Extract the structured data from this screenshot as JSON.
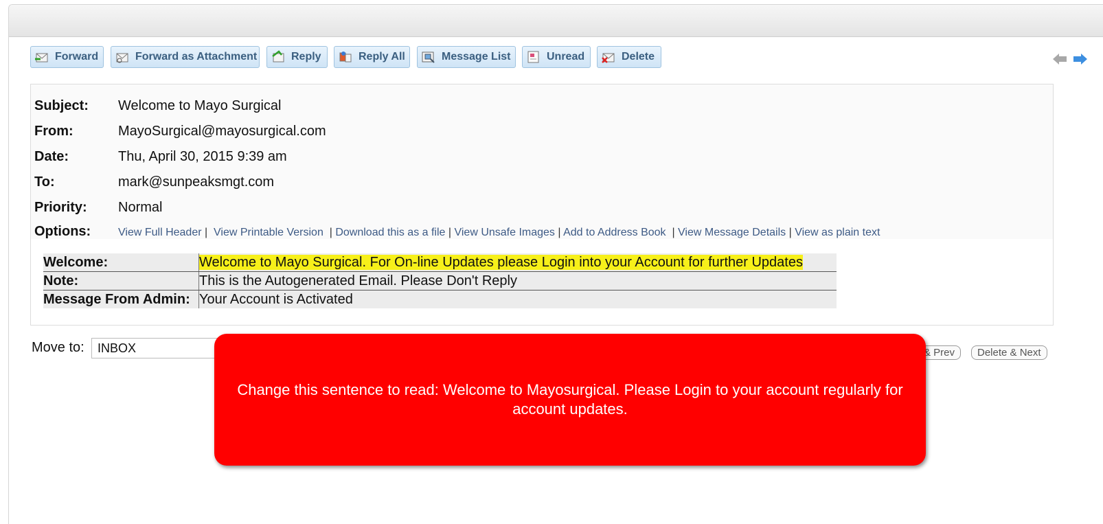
{
  "toolbar": {
    "forward": "Forward",
    "forward_attachment": "Forward as Attachment",
    "reply": "Reply",
    "reply_all": "Reply All",
    "message_list": "Message List",
    "unread": "Unread",
    "delete": "Delete"
  },
  "headers": {
    "subject": {
      "label": "Subject:",
      "value": "Welcome to Mayo Surgical"
    },
    "from": {
      "label": "From:",
      "value": "MayoSurgical@mayosurgical.com"
    },
    "date": {
      "label": "Date:",
      "value": "Thu, April 30, 2015 9:39 am"
    },
    "to": {
      "label": "To:",
      "value": "mark@sunpeaksmgt.com"
    },
    "priority": {
      "label": "Priority:",
      "value": "Normal"
    },
    "options": {
      "label": "Options:",
      "links": [
        "View Full Header",
        "View Printable Version",
        "Download this as a file",
        "View Unsafe Images",
        "Add to Address Book",
        "View Message Details",
        "View as plain text"
      ]
    }
  },
  "message": {
    "rows": [
      {
        "key": "Welcome:",
        "value": "Welcome to Mayo Surgical. For On-line Updates please Login into your Account for further Updates"
      },
      {
        "key": "Note:",
        "value": "This is the Autogenerated Email. Please Don't Reply"
      },
      {
        "key": "Message From Admin:",
        "value": "Your Account is Activated"
      }
    ]
  },
  "footer": {
    "move_to_label": "Move to:",
    "move_to_value": "INBOX",
    "delete_prev": "& Prev",
    "delete_next": "Delete & Next"
  },
  "callout": {
    "text": "Change this sentence to read:  Welcome to Mayosurgical.  Please Login to your account regularly for account updates."
  },
  "icons": [
    "forward-icon",
    "forward-attachment-icon",
    "reply-icon",
    "reply-all-icon",
    "message-list-icon",
    "unread-icon",
    "delete-icon",
    "previous-arrow-icon",
    "next-arrow-icon"
  ],
  "colors": {
    "callout": "#ff0000",
    "highlight": "#f7f01a",
    "link": "#3d5a85",
    "button_text": "#3b5f80"
  }
}
